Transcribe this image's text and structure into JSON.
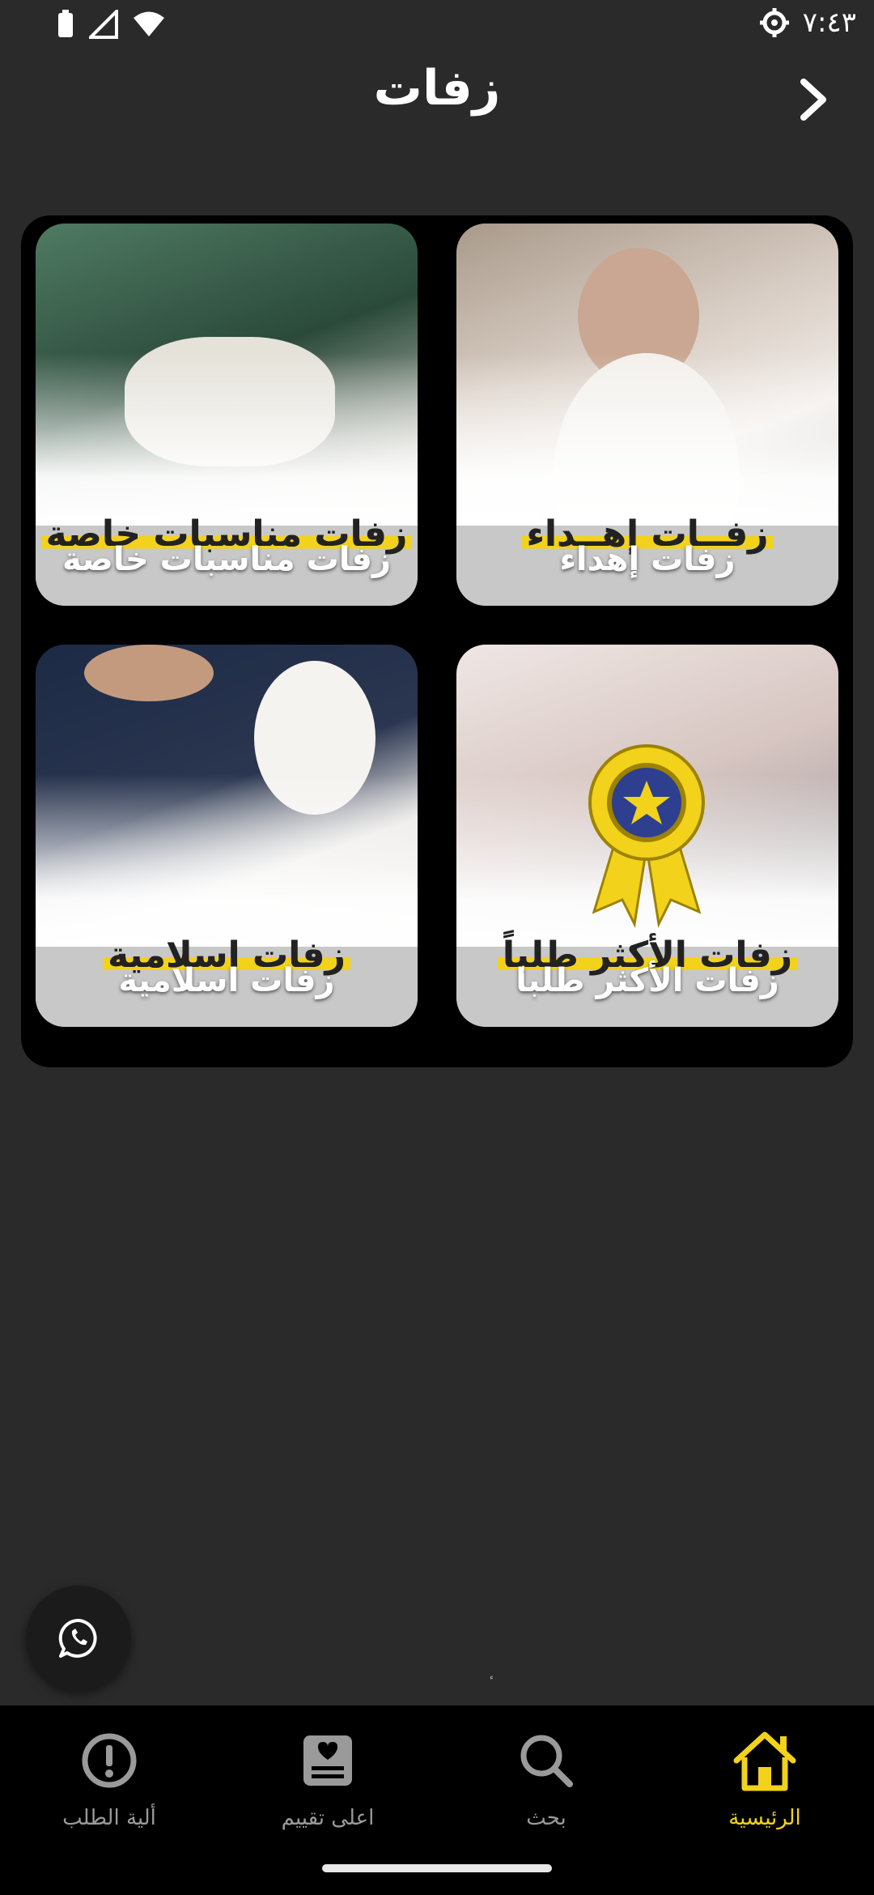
{
  "status_bar": {
    "time": "٧:٤٣"
  },
  "header": {
    "title": "زفات"
  },
  "cards": [
    {
      "banner_text": "زفــات إهــداء",
      "label": "زفات إهداء"
    },
    {
      "banner_text": "زفات مناسبات خاصة",
      "label": "زفات مناسبات خاصة"
    },
    {
      "banner_text": "زفات الأكثر طلباً",
      "label": "زفات الأكثر طلبا"
    },
    {
      "banner_text": "زفات اسلامية",
      "label": "زفات اسلامية"
    }
  ],
  "tiny_mark": "ٔ",
  "bottom_nav": {
    "items": [
      {
        "label": "الرئيسية",
        "icon": "home-icon",
        "active": true
      },
      {
        "label": "بحث",
        "icon": "search-icon",
        "active": false
      },
      {
        "label": "اعلى تقييم",
        "icon": "rating-icon",
        "active": false
      },
      {
        "label": "ألية الطلب",
        "icon": "alert-icon",
        "active": false
      }
    ]
  },
  "colors": {
    "accent": "#f2d21b",
    "background": "#2a2a2a",
    "nav_bg": "#000000"
  }
}
